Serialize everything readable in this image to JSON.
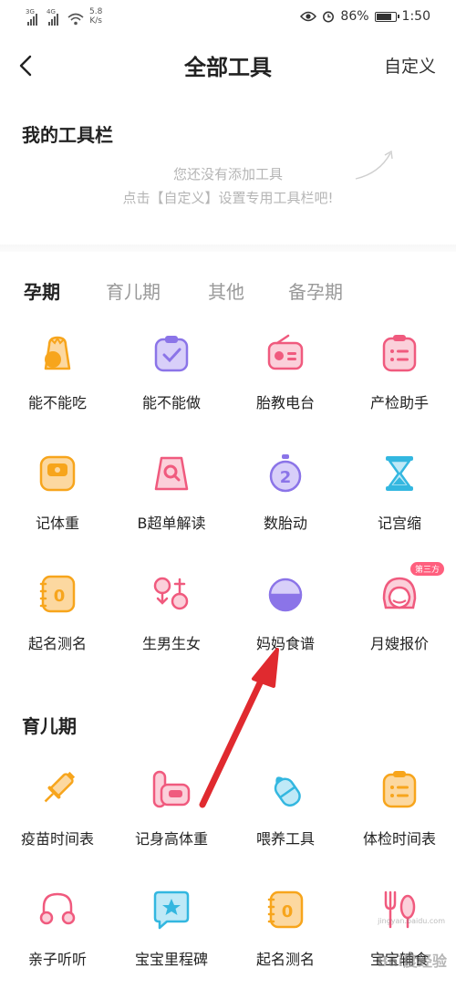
{
  "status_bar": {
    "network_left": "3G",
    "network_right": "4G",
    "speed_value": "5.8",
    "speed_unit": "K/s",
    "battery": "86%",
    "battery_level": 0.86,
    "time": "1:50"
  },
  "navbar": {
    "title": "全部工具",
    "custom_label": "自定义"
  },
  "my_toolbar": {
    "title": "我的工具栏",
    "hint_line1": "您还没有添加工具",
    "hint_line2": "点击【自定义】设置专用工具栏吧!"
  },
  "tabs": [
    "孕期",
    "育儿期",
    "其他",
    "备孕期"
  ],
  "tabs_active": 0,
  "section_pregnancy": {
    "tools": [
      {
        "label": "能不能吃",
        "icon": "food-bag-icon"
      },
      {
        "label": "能不能做",
        "icon": "clipboard-check-icon"
      },
      {
        "label": "胎教电台",
        "icon": "radio-icon"
      },
      {
        "label": "产检助手",
        "icon": "checklist-icon"
      },
      {
        "label": "记体重",
        "icon": "scale-icon"
      },
      {
        "label": "B超单解读",
        "icon": "ultrasound-icon"
      },
      {
        "label": "数胎动",
        "icon": "stopwatch-icon"
      },
      {
        "label": "记宫缩",
        "icon": "hourglass-icon"
      },
      {
        "label": "起名测名",
        "icon": "name-book-icon"
      },
      {
        "label": "生男生女",
        "icon": "gender-icon"
      },
      {
        "label": "妈妈食谱",
        "icon": "bowl-icon"
      },
      {
        "label": "月嫂报价",
        "icon": "nanny-icon",
        "badge": "第三方"
      }
    ]
  },
  "section_childcare": {
    "title": "育儿期",
    "tools": [
      {
        "label": "疫苗时间表",
        "icon": "vaccine-icon"
      },
      {
        "label": "记身高体重",
        "icon": "height-scale-icon"
      },
      {
        "label": "喂养工具",
        "icon": "feeding-bottle-icon"
      },
      {
        "label": "体检时间表",
        "icon": "checkup-icon"
      },
      {
        "label": "亲子听听",
        "icon": "music-note-icon"
      },
      {
        "label": "宝宝里程碑",
        "icon": "milestone-icon"
      },
      {
        "label": "起名测名",
        "icon": "name-book-icon"
      },
      {
        "label": "宝宝辅食",
        "icon": "utensils-icon"
      }
    ]
  },
  "colors": {
    "orange": "#f7a51c",
    "purple": "#8b74e8",
    "pink": "#f05a7e",
    "teal": "#33b7e0",
    "arrow_red": "#e02a2f"
  },
  "watermark": "Bai度经验",
  "watermark_url": "jingyan.baidu.com"
}
